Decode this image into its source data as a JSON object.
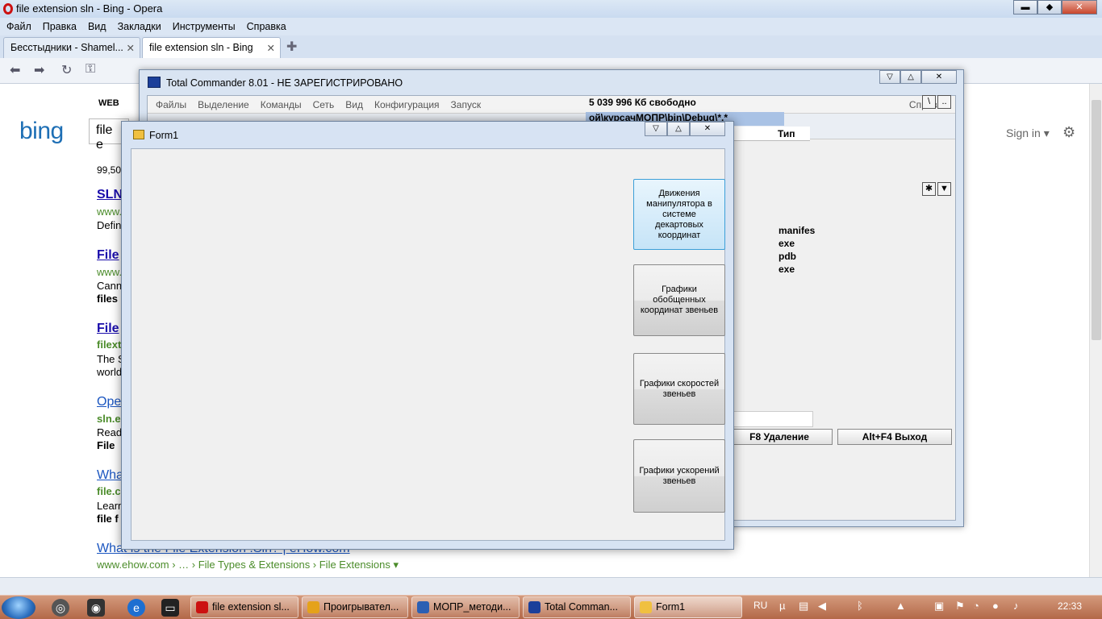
{
  "opera": {
    "title": "file extension sln - Bing - Opera",
    "menu": [
      "Файл",
      "Правка",
      "Вид",
      "Закладки",
      "Инструменты",
      "Справка"
    ],
    "tabs": [
      {
        "label": "Бесстыдники - Shamel..."
      },
      {
        "label": "file extension sln - Bing"
      }
    ]
  },
  "bing": {
    "logo": "bing",
    "nav_web": "WEB",
    "query_visible": "file e",
    "sign_in": "Sign in ▾",
    "results_count": "99,50",
    "results": [
      {
        "kind": "link",
        "text": "SLN"
      },
      {
        "kind": "green",
        "text": "www."
      },
      {
        "kind": "text",
        "text": "Defin"
      },
      {
        "kind": "link",
        "text": "File"
      },
      {
        "kind": "green",
        "text": "www."
      },
      {
        "kind": "text",
        "text": "Cann"
      },
      {
        "kind": "bold",
        "text": "files"
      },
      {
        "kind": "link",
        "text": "File"
      },
      {
        "kind": "green",
        "text": "filext"
      },
      {
        "kind": "text",
        "text": "The S"
      },
      {
        "kind": "text",
        "text": "world"
      },
      {
        "kind": "link2",
        "text": "Ope"
      },
      {
        "kind": "green",
        "text": "sln.e"
      },
      {
        "kind": "text",
        "text": "Read"
      },
      {
        "kind": "bold",
        "text": "File"
      },
      {
        "kind": "link2",
        "text": "What"
      },
      {
        "kind": "green",
        "text": "file.c"
      },
      {
        "kind": "text",
        "text": "Learn"
      },
      {
        "kind": "bold",
        "text": "file f"
      },
      {
        "kind": "link2",
        "text": "What is the File Extension .Sln? | eHow.com"
      },
      {
        "kind": "green",
        "text": "www.ehow.com › … › File Types & Extensions › File Extensions ▾"
      }
    ]
  },
  "tc": {
    "title": "Total Commander 8.01 - НЕ ЗАРЕГИСТРИРОВАНО",
    "menu": [
      "Файлы",
      "Выделение",
      "Команды",
      "Сеть",
      "Вид",
      "Конфигурация",
      "Запуск"
    ],
    "help": "Справка",
    "free": "5 039 996 Кб свободно",
    "path": "ой\\курсачМОПР\\bin\\Debug\\*.*",
    "type_header": "Тип",
    "types": [
      "manifes",
      "exe",
      "pdb",
      "exe"
    ],
    "f8": "F8 Удаление",
    "altf4": "Alt+F4 Выход"
  },
  "form1": {
    "title": "Form1",
    "buttons": [
      "Движения манипулятора в системе декартовых координат",
      "Графики обобщенных координат звеньев",
      "Графики скоростей звеньев",
      "Графики ускорений звеньев"
    ]
  },
  "taskbar": {
    "items": [
      {
        "label": "file extension sl...",
        "color": "#cc1111"
      },
      {
        "label": "Проигрывател...",
        "color": "#e5a21a"
      },
      {
        "label": "МОПР_методи...",
        "color": "#2b5fb3"
      },
      {
        "label": "Total Comman...",
        "color": "#1b3f9a"
      },
      {
        "label": "Form1",
        "color": "#f0c040"
      }
    ],
    "lang": "RU",
    "clock": "22:33"
  }
}
